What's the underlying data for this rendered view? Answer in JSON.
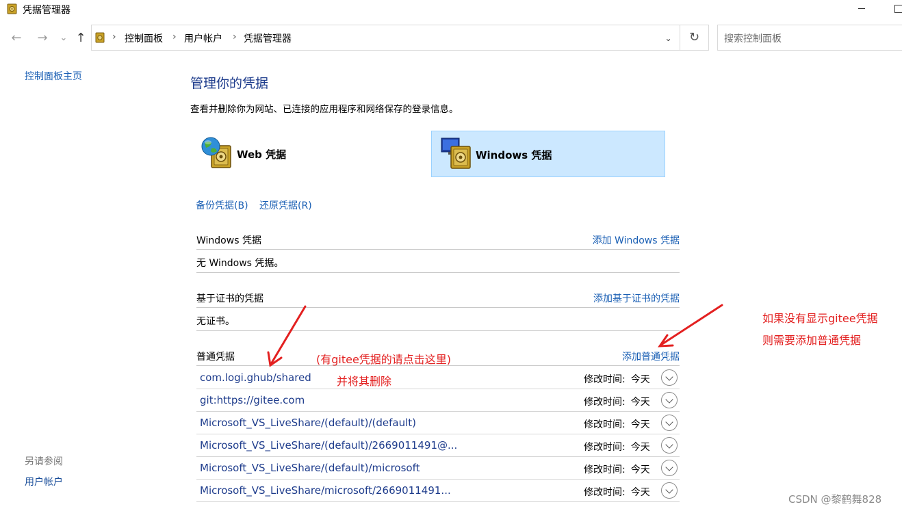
{
  "window": {
    "title": "凭据管理器",
    "icon": "vault-icon"
  },
  "nav": {
    "back": "←",
    "forward": "→",
    "recent": "⌄",
    "up": "↑",
    "breadcrumbs": [
      "控制面板",
      "用户帐户",
      "凭据管理器"
    ],
    "dropdown": "⌄",
    "refresh": "↻",
    "search_placeholder": "搜索控制面板"
  },
  "sidebar": {
    "home": "控制面板主页",
    "see_also": "另请参阅",
    "user_accounts": "用户帐户"
  },
  "main": {
    "title": "管理你的凭据",
    "description": "查看并删除你为网站、已连接的应用程序和网络保存的登录信息。",
    "tiles": [
      {
        "label": "Web 凭据",
        "icon": "globe-vault-icon",
        "selected": false
      },
      {
        "label": "Windows 凭据",
        "icon": "computer-vault-icon",
        "selected": true
      }
    ],
    "backup": "备份凭据(B)",
    "restore": "还原凭据(R)",
    "sections": {
      "windows": {
        "title": "Windows 凭据",
        "add": "添加 Windows 凭据",
        "empty": "无 Windows 凭据。"
      },
      "certificate": {
        "title": "基于证书的凭据",
        "add": "添加基于证书的凭据",
        "empty": "无证书。"
      },
      "generic": {
        "title": "普通凭据",
        "add": "添加普通凭据",
        "items": [
          {
            "name": "com.logi.ghub/shared",
            "modified_label": "修改时间:",
            "modified": "今天"
          },
          {
            "name": "git:https://gitee.com",
            "modified_label": "修改时间:",
            "modified": "今天"
          },
          {
            "name": "Microsoft_VS_LiveShare/(default)/(default)",
            "modified_label": "修改时间:",
            "modified": "今天"
          },
          {
            "name": "Microsoft_VS_LiveShare/(default)/2669011491@...",
            "modified_label": "修改时间:",
            "modified": "今天"
          },
          {
            "name": "Microsoft_VS_LiveShare/(default)/microsoft",
            "modified_label": "修改时间:",
            "modified": "今天"
          },
          {
            "name": "Microsoft_VS_LiveShare/microsoft/2669011491...",
            "modified_label": "修改时间:",
            "modified": "今天"
          }
        ]
      }
    }
  },
  "annotations": {
    "note1_line1": "(有gitee凭据的请点击这里)",
    "note1_line2": "并将其删除",
    "note2_line1": "如果没有显示gitee凭据",
    "note2_line2": "则需要添加普通凭据",
    "color": "#e32020"
  },
  "watermark": "CSDN @黎鹤舞828"
}
